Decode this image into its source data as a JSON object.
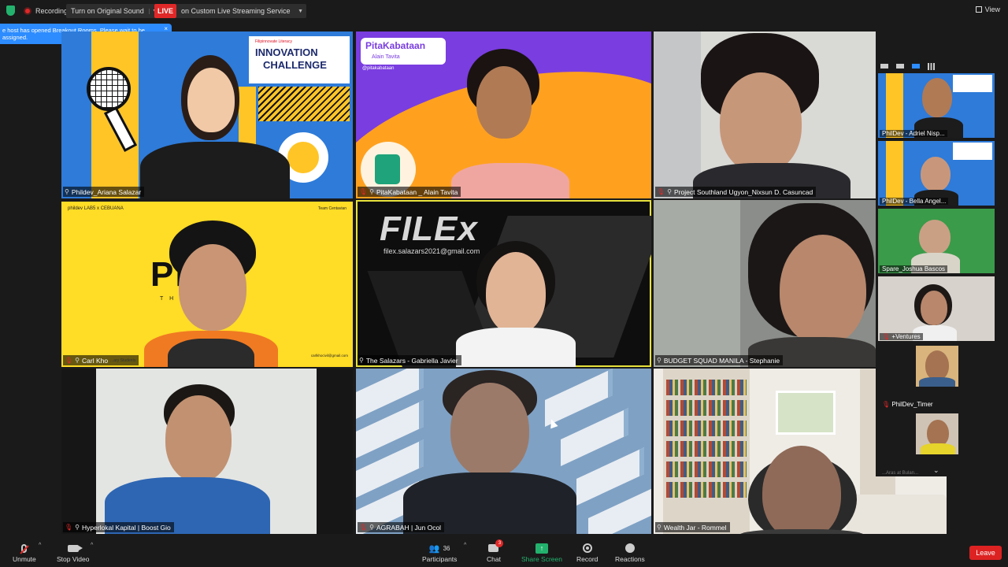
{
  "topbar": {
    "recording_label": "Recording",
    "sound_label": "Turn on Original Sound",
    "live_label": "LIVE",
    "stream_label": "on Custom Live Streaming Service",
    "view_label": "View"
  },
  "notice": {
    "text": "e host has opened Breakout Rooms. Please wait to be assigned."
  },
  "tiles": [
    {
      "name": "Phildev_Ariana Salazar"
    },
    {
      "name": "PitaKabataan _ Alain Tavita",
      "brand": "PitaKabataan",
      "brand_sub": "Alain Tavita",
      "handle": "@pitakabataan"
    },
    {
      "name": "Project Southland Ugyon_Nixsun D. Casuncad"
    },
    {
      "name": "Carl Kho",
      "header": "phildev LAB5 x CEBUANA",
      "team": "Team Centavian",
      "big": "Pl   s",
      "sub": "T H E           E",
      "email": "carlkhocivil@gmail.com",
      "footer_text": "...ary Students"
    },
    {
      "name": "The Salazars - Gabriella Javier",
      "logo": "FILEx",
      "email": "filex.salazars2021@gmail.com"
    },
    {
      "name": "BUDGET SQUAD MANILA - Stephanie"
    },
    {
      "name": "Hyperlokal Kapital | Boost Gio"
    },
    {
      "name": "AGRABAH | Jun Ocol"
    },
    {
      "name": "Wealth Jar - Rommel"
    }
  ],
  "tile1_logo": {
    "l1": "Filipinnovate Literacy",
    "l2": "INNOVATION",
    "l3": "CHALLENGE"
  },
  "filmstrip": [
    {
      "name": "PhilDev - Adriel Nisp..."
    },
    {
      "name": "PhilDev - Bella Angel..."
    },
    {
      "name": "Spare_Joshua Bascos"
    },
    {
      "name": "+Ventures"
    },
    {
      "name": "PhilDev_Timer"
    },
    {
      "name": "...Aras at Bulan..."
    }
  ],
  "toolbar": {
    "unmute": "Unmute",
    "stop_video": "Stop Video",
    "participants": "Participants",
    "participant_count": "36",
    "chat": "Chat",
    "chat_badge": "3",
    "share": "Share Screen",
    "record": "Record",
    "reactions": "Reactions",
    "leave": "Leave"
  },
  "colors": {
    "live_red": "#e02828",
    "share_green": "#23b26d",
    "notice_blue": "#2d8cff",
    "active_speaker": "#e8e23c"
  }
}
